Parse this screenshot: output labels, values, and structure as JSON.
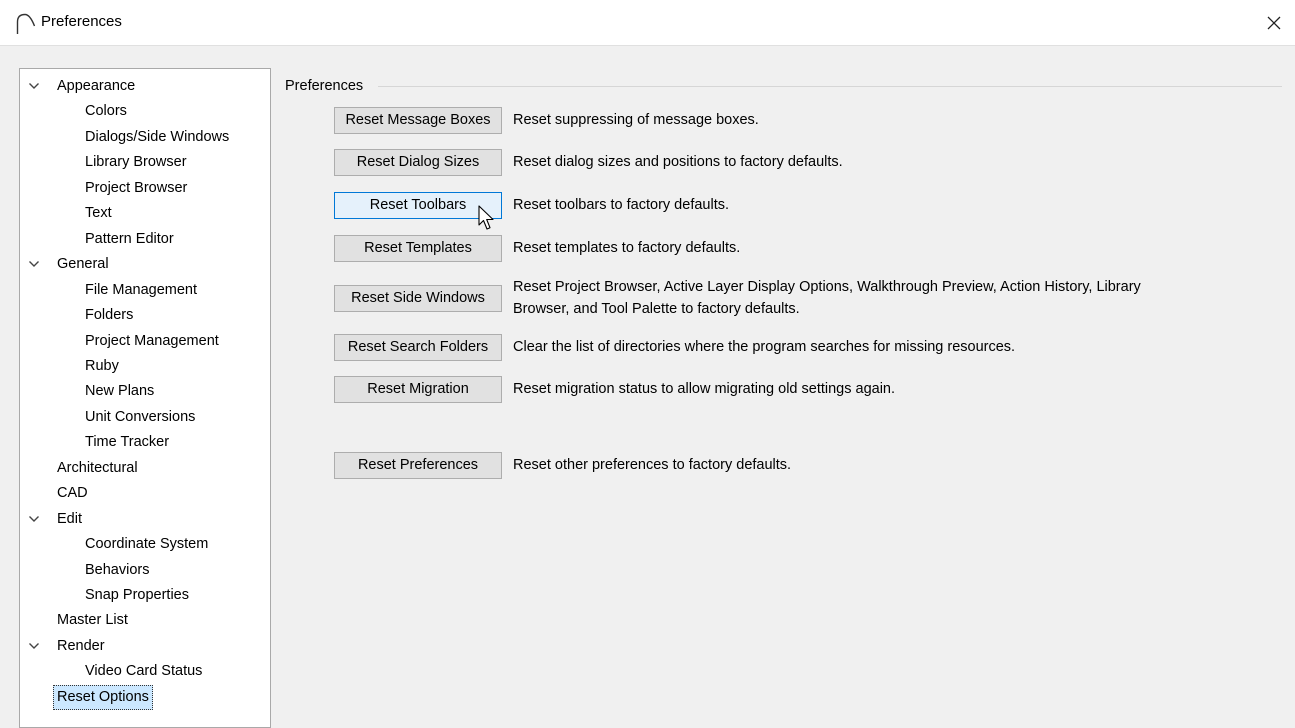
{
  "window": {
    "title": "Preferences",
    "close_icon": "close-icon",
    "app_icon": "arc-logo-icon"
  },
  "tree": [
    {
      "label": "Appearance",
      "level": 0,
      "expanded": true
    },
    {
      "label": "Colors",
      "level": 1
    },
    {
      "label": "Dialogs/Side Windows",
      "level": 1
    },
    {
      "label": "Library Browser",
      "level": 1
    },
    {
      "label": "Project Browser",
      "level": 1
    },
    {
      "label": "Text",
      "level": 1
    },
    {
      "label": "Pattern Editor",
      "level": 1
    },
    {
      "label": "General",
      "level": 0,
      "expanded": true
    },
    {
      "label": "File Management",
      "level": 1
    },
    {
      "label": "Folders",
      "level": 1
    },
    {
      "label": "Project Management",
      "level": 1
    },
    {
      "label": "Ruby",
      "level": 1
    },
    {
      "label": "New Plans",
      "level": 1
    },
    {
      "label": "Unit Conversions",
      "level": 1
    },
    {
      "label": "Time Tracker",
      "level": 1
    },
    {
      "label": "Architectural",
      "level": 0
    },
    {
      "label": "CAD",
      "level": 0
    },
    {
      "label": "Edit",
      "level": 0,
      "expanded": true
    },
    {
      "label": "Coordinate System",
      "level": 1
    },
    {
      "label": "Behaviors",
      "level": 1
    },
    {
      "label": "Snap Properties",
      "level": 1
    },
    {
      "label": "Master List",
      "level": 0
    },
    {
      "label": "Render",
      "level": 0,
      "expanded": true
    },
    {
      "label": "Video Card Status",
      "level": 1
    },
    {
      "label": "Reset Options",
      "level": 0,
      "selected": true
    }
  ],
  "panel": {
    "group_label": "Preferences",
    "rows": [
      {
        "button": "Reset Message Boxes",
        "desc": [
          "Reset suppressing of message boxes."
        ]
      },
      {
        "button": "Reset Dialog Sizes",
        "desc": [
          "Reset dialog sizes and positions to factory defaults."
        ]
      },
      {
        "button": "Reset Toolbars",
        "desc": [
          "Reset toolbars to factory defaults."
        ],
        "hover": true
      },
      {
        "button": "Reset Templates",
        "desc": [
          "Reset templates to factory defaults."
        ]
      },
      {
        "button": "Reset Side Windows",
        "desc": [
          "Reset Project Browser, Active Layer Display Options, Walkthrough Preview, Action History, Library",
          "Browser, and Tool Palette to factory defaults."
        ]
      },
      {
        "button": "Reset Search Folders",
        "desc": [
          "Clear the list of directories where the program searches for missing resources."
        ]
      },
      {
        "button": "Reset Migration",
        "desc": [
          "Reset migration status to allow migrating old settings again."
        ]
      },
      {
        "button": "Reset Preferences",
        "desc": [
          "Reset other preferences to factory defaults."
        ]
      }
    ]
  },
  "colors": {
    "selection": "#cce8ff",
    "button_hover_border": "#0078d7",
    "button_face": "#e1e1e1"
  }
}
